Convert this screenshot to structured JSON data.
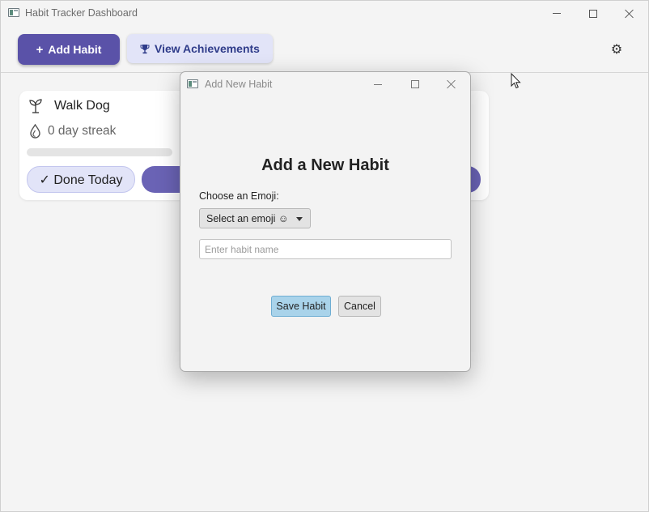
{
  "window": {
    "title": "Habit Tracker Dashboard"
  },
  "toolbar": {
    "add_habit_label": "Add Habit",
    "add_habit_icon": "+",
    "achievements_label": "View Achievements",
    "achievements_icon": "trophy-icon",
    "settings_icon": "gear-icon",
    "accent_color": "#5a52a8"
  },
  "habits": [
    {
      "icon": "sprout-icon",
      "name": "Walk Dog",
      "streak_icon": "drop-icon",
      "streak_text": "0 day streak",
      "progress": 0,
      "done_label": "✓ Done Today"
    }
  ],
  "dialog": {
    "title": "Add New Habit",
    "heading": "Add a New Habit",
    "emoji_label": "Choose an Emoji:",
    "emoji_select_value": "Select an emoji ☺",
    "name_placeholder": "Enter habit name",
    "name_value": "",
    "save_label": "Save Habit",
    "cancel_label": "Cancel",
    "save_color": "#a9d3ea"
  }
}
